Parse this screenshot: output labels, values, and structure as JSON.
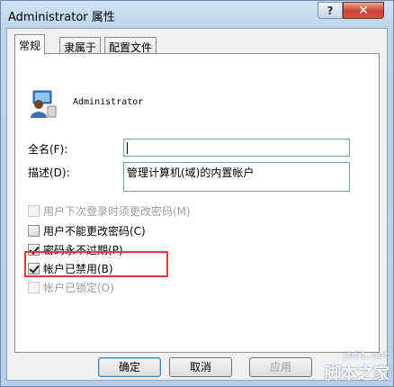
{
  "window": {
    "title": "Administrator 属性",
    "help_glyph": "?",
    "close_glyph": "✕"
  },
  "tabs": [
    {
      "label": "常规",
      "active": true
    },
    {
      "label": "隶属于",
      "active": false
    },
    {
      "label": "配置文件",
      "active": false
    }
  ],
  "user": {
    "icon": "user-icon",
    "name": "Administrator"
  },
  "fields": {
    "fullname": {
      "label": "全名(F):",
      "value": ""
    },
    "description": {
      "label": "描述(D):",
      "value": "管理计算机(域)的内置帐户"
    }
  },
  "checkboxes": [
    {
      "label": "用户下次登录时须更改密码(M)",
      "checked": false,
      "disabled": true
    },
    {
      "label": "用户不能更改密码(C)",
      "checked": false,
      "disabled": false
    },
    {
      "label": "密码永不过期(P)",
      "checked": true,
      "disabled": false
    },
    {
      "label": "帐户已禁用(B)",
      "checked": true,
      "disabled": false
    },
    {
      "label": "帐户已锁定(O)",
      "checked": false,
      "disabled": true
    }
  ],
  "buttons": {
    "ok": "确定",
    "cancel": "取消",
    "apply": "应用"
  },
  "watermark": {
    "url": "jb51.net",
    "title": "脚本之家"
  },
  "colors": {
    "highlight": "#e23a3a",
    "frame": "#bcd4ec"
  }
}
